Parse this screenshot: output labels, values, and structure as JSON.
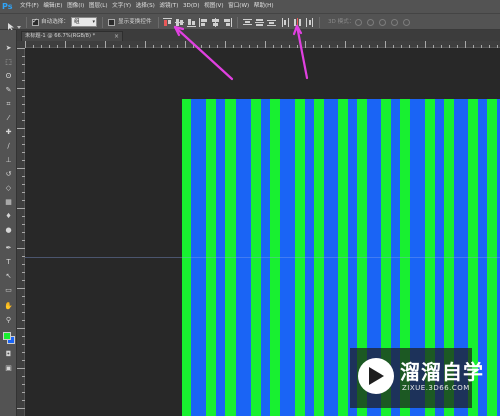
{
  "app": {
    "logo": "Ps",
    "menu": [
      "文件(F)",
      "编辑(E)",
      "图像(I)",
      "图层(L)",
      "文字(Y)",
      "选择(S)",
      "滤镜(T)",
      "3D(D)",
      "视图(V)",
      "窗口(W)",
      "帮助(H)"
    ]
  },
  "options": {
    "auto_select_label": "自动选择：",
    "auto_select_checked": true,
    "auto_select_value": "组",
    "show_transform_label": "显示变换控件",
    "show_transform_checked": false,
    "mode_label": "3D 模式："
  },
  "document": {
    "tab_title": "未标题-1 @ 66.7%(RGB/8) *",
    "close_glyph": "×",
    "background_color": "#1a64f5",
    "stripe_color": "#18f030"
  },
  "toolbox": {
    "foreground_color": "#18f030",
    "background_color": "#1a64f5",
    "tools": [
      "move-tool",
      "marquee-tool",
      "lasso-tool",
      "quick-select-tool",
      "crop-tool",
      "eyedropper-tool",
      "healing-brush-tool",
      "brush-tool",
      "clone-stamp-tool",
      "history-brush-tool",
      "eraser-tool",
      "gradient-tool",
      "blur-tool",
      "dodge-tool",
      "pen-tool",
      "type-tool",
      "path-select-tool",
      "rectangle-tool",
      "hand-tool",
      "zoom-tool"
    ]
  },
  "annotations": {
    "arrow_color": "#e040e0"
  },
  "watermark": {
    "title": "溜溜自学",
    "url": "ZIXUE.3D66.COM"
  }
}
